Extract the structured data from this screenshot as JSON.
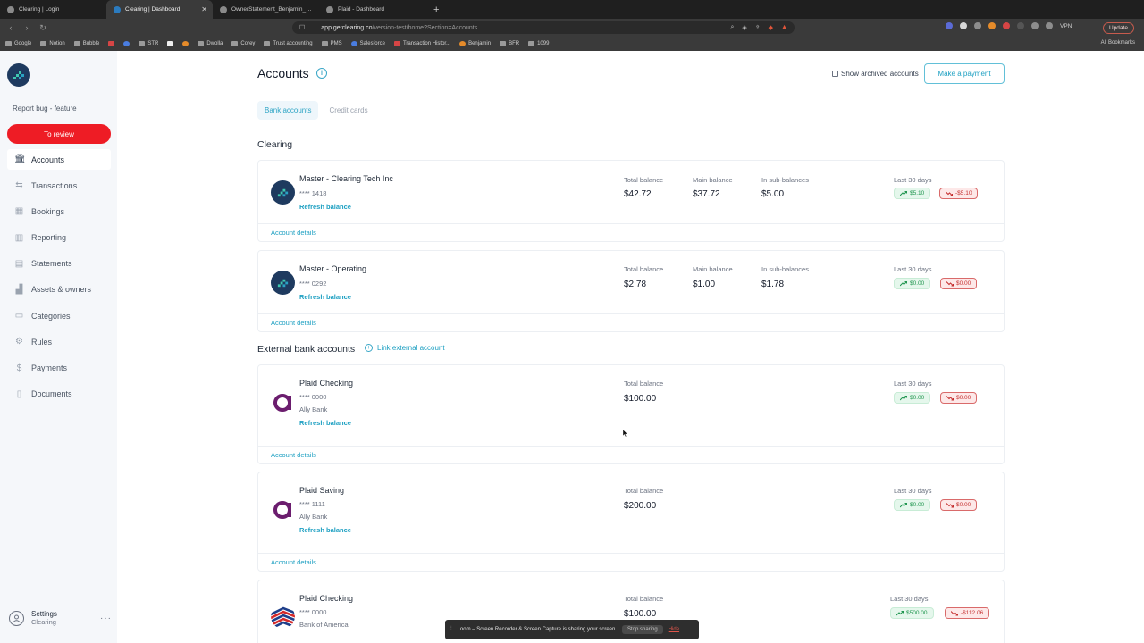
{
  "browser": {
    "tabs": [
      {
        "title": "Clearing | Login",
        "active": false
      },
      {
        "title": "Clearing | Dashboard",
        "active": true
      },
      {
        "title": "OwnerStatement_Benjamin_Elbaz",
        "active": false
      },
      {
        "title": "Plaid - Dashboard",
        "active": false
      }
    ],
    "new_tab": "+",
    "url_host": "app.getclearing.co",
    "url_path": "/version-test/home?Section=Accounts",
    "vpn": "VPN",
    "update": "Update",
    "bookmarks": [
      "Google",
      "Notion",
      "Bubble",
      "STR",
      "Dwolla",
      "Corey",
      "Trust accounting",
      "PMS",
      "Salesforce",
      "Transaction Histor...",
      "Benjamin",
      "BFR",
      "1099"
    ],
    "all_bookmarks": "All Bookmarks"
  },
  "sidebar": {
    "report_bug": "Report bug - feature",
    "to_review": "To review",
    "items": [
      {
        "label": "Accounts",
        "icon": "bank-icon",
        "active": true
      },
      {
        "label": "Transactions",
        "icon": "arrows-icon",
        "active": false
      },
      {
        "label": "Bookings",
        "icon": "calendar-icon",
        "active": false
      },
      {
        "label": "Reporting",
        "icon": "bar-chart-icon",
        "active": false
      },
      {
        "label": "Statements",
        "icon": "document-icon",
        "active": false
      },
      {
        "label": "Assets & owners",
        "icon": "building-icon",
        "active": false
      },
      {
        "label": "Categories",
        "icon": "folder-icon",
        "active": false
      },
      {
        "label": "Rules",
        "icon": "gear-icon",
        "active": false
      },
      {
        "label": "Payments",
        "icon": "dollar-icon",
        "active": false
      },
      {
        "label": "Documents",
        "icon": "file-icon",
        "active": false
      }
    ],
    "settings_label": "Settings",
    "settings_sub": "Clearing",
    "more": "···"
  },
  "main": {
    "title": "Accounts",
    "show_archived": "Show archived accounts",
    "make_payment": "Make a payment",
    "tabs": [
      {
        "label": "Bank accounts",
        "active": true
      },
      {
        "label": "Credit cards",
        "active": false
      }
    ],
    "clearing_section": "Clearing",
    "external_section": "External bank accounts",
    "link_external": "Link external account",
    "labels": {
      "total_balance": "Total balance",
      "main_balance": "Main balance",
      "sub_balances": "In sub-balances",
      "last_30": "Last 30 days",
      "refresh": "Refresh balance",
      "details": "Account details"
    },
    "accounts": [
      {
        "name": "Master - Clearing Tech Inc",
        "mask": "**** 1418",
        "total": "$42.72",
        "main": "$37.72",
        "sub": "$5.00",
        "up": "$5.10",
        "down": "-$5.10"
      },
      {
        "name": "Master - Operating",
        "mask": "**** 0292",
        "total": "$2.78",
        "main": "$1.00",
        "sub": "$1.78",
        "up": "$0.00",
        "down": "$0.00"
      },
      {
        "name": "Plaid Checking",
        "mask": "**** 0000",
        "bank": "Ally Bank",
        "total": "$100.00",
        "up": "$0.00",
        "down": "$0.00"
      },
      {
        "name": "Plaid Saving",
        "mask": "**** 1111",
        "bank": "Ally Bank",
        "total": "$200.00",
        "up": "$0.00",
        "down": "$0.00"
      },
      {
        "name": "Plaid Checking",
        "mask": "**** 0000",
        "bank": "Bank of America",
        "total": "$100.00",
        "up": "$500.00",
        "down": "-$112.06"
      }
    ]
  },
  "loom": {
    "message": "Loom – Screen Recorder & Screen Capture is sharing your screen.",
    "stop": "Stop sharing",
    "hide": "Hide"
  },
  "colors": {
    "accent": "#1ea0c2",
    "danger": "#ee1c25",
    "positive": "#20964f",
    "negative": "#c53030",
    "ally": "#6b1d6e"
  }
}
